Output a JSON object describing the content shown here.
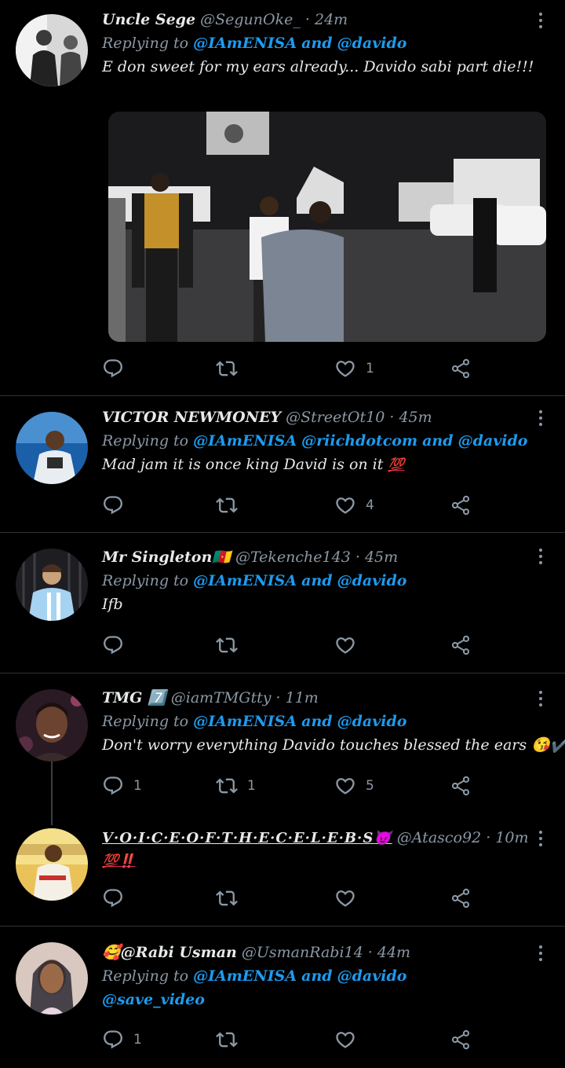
{
  "tweets": [
    {
      "name": "Uncle Sege",
      "handle": "@SegunOke_",
      "time": "24m",
      "replying_prefix": "Replying to",
      "mentions": [
        "@IAmENISA",
        "@davido"
      ],
      "joiner": "and",
      "text": "E don sweet for my ears already... Davido sabi part die!!!",
      "replies": "",
      "retweets": "",
      "likes": "1"
    },
    {
      "name": "VICTOR NEWMONEY",
      "handle": "@StreetOt10",
      "time": "45m",
      "replying_prefix": "Replying to",
      "mentions": [
        "@IAmENISA",
        "@riichdotcom",
        "@davido"
      ],
      "joiner": "and",
      "text": "Mad jam it is once king David is on it",
      "text_emoji": "💯",
      "replies": "",
      "retweets": "",
      "likes": "4"
    },
    {
      "name": "Mr Singleton",
      "name_emoji": "🇨🇲",
      "handle": "@Tekenche143",
      "time": "45m",
      "replying_prefix": "Replying to",
      "mentions": [
        "@IAmENISA",
        "@davido"
      ],
      "joiner": "and",
      "text": "Ifb",
      "replies": "",
      "retweets": "",
      "likes": ""
    },
    {
      "name": "TMG",
      "name_emoji": "7️⃣",
      "handle": "@iamTMGtty",
      "time": "11m",
      "replying_prefix": "Replying to",
      "mentions": [
        "@IAmENISA",
        "@davido"
      ],
      "joiner": "and",
      "text": "Don't worry everything Davido touches blessed the ears",
      "text_emoji": "😘✔️",
      "replies": "1",
      "retweets": "1",
      "likes": "5"
    },
    {
      "name": "V·O·I·C·E·O·F·T·H·E·C·E·L·E·B·S",
      "name_emoji": "😈",
      "handle": "@Atasco92",
      "time": "10m",
      "text": "",
      "text_emoji": "💯‼️",
      "replies": "",
      "retweets": "",
      "likes": ""
    },
    {
      "name": "@Rabi Usman",
      "name_prefix_emoji": "🥰",
      "handle": "@UsmanRabi14",
      "time": "44m",
      "replying_prefix": "Replying to",
      "mentions": [
        "@IAmENISA",
        "@davido"
      ],
      "joiner": "and",
      "text": "@save_video",
      "replies": "1",
      "retweets": "",
      "likes": ""
    }
  ],
  "colors": {
    "background": "#000000",
    "mention": "#1d9bf0",
    "muted": "#8b98a5",
    "divider": "#2f3336"
  },
  "icons": [
    "reply-icon",
    "retweet-icon",
    "like-icon",
    "share-icon",
    "more-icon"
  ]
}
